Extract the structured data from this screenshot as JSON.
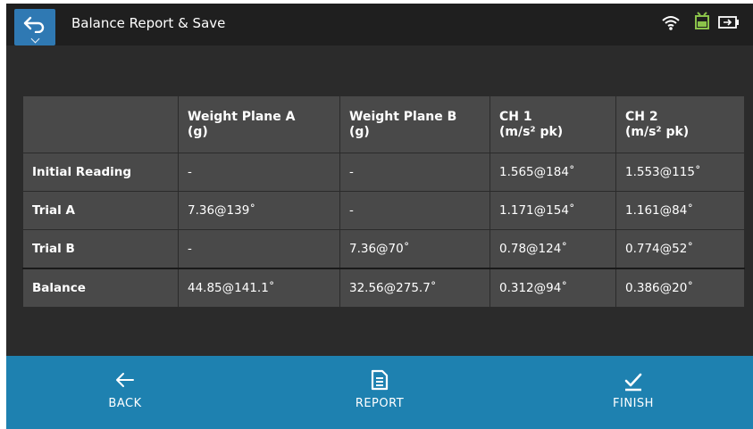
{
  "header": {
    "title": "Balance Report & Save",
    "icons": [
      "back-arrow-icon",
      "wifi-icon",
      "battery-device-icon",
      "battery-charging-icon"
    ]
  },
  "table": {
    "headers": [
      {
        "name": "",
        "unit": ""
      },
      {
        "name": "Weight Plane A",
        "unit": "(g)"
      },
      {
        "name": "Weight Plane B",
        "unit": "(g)"
      },
      {
        "name": "CH 1",
        "unit": "(m/s² pk)"
      },
      {
        "name": "CH 2",
        "unit": "(m/s² pk)"
      }
    ],
    "rows": [
      {
        "label": "Initial Reading",
        "cells": [
          "-",
          "-",
          "1.565@184˚",
          "1.553@115˚"
        ]
      },
      {
        "label": "Trial A",
        "cells": [
          "7.36@139˚",
          "-",
          "1.171@154˚",
          "1.161@84˚"
        ]
      },
      {
        "label": "Trial B",
        "cells": [
          "-",
          "7.36@70˚",
          "0.78@124˚",
          "0.774@52˚"
        ]
      },
      {
        "label": "Balance",
        "cells": [
          "44.85@141.1˚",
          "32.56@275.7˚",
          "0.312@94˚",
          "0.386@20˚"
        ]
      }
    ]
  },
  "footer": {
    "back_label": "BACK",
    "report_label": "REPORT",
    "finish_label": "FINISH"
  },
  "colors": {
    "background": "#2b2b2b",
    "topbar": "#1f1f1f",
    "accent": "#2f79b3",
    "bottombar": "#1e81b0",
    "table_cell": "#494949",
    "status_green": "#8bc34a"
  }
}
